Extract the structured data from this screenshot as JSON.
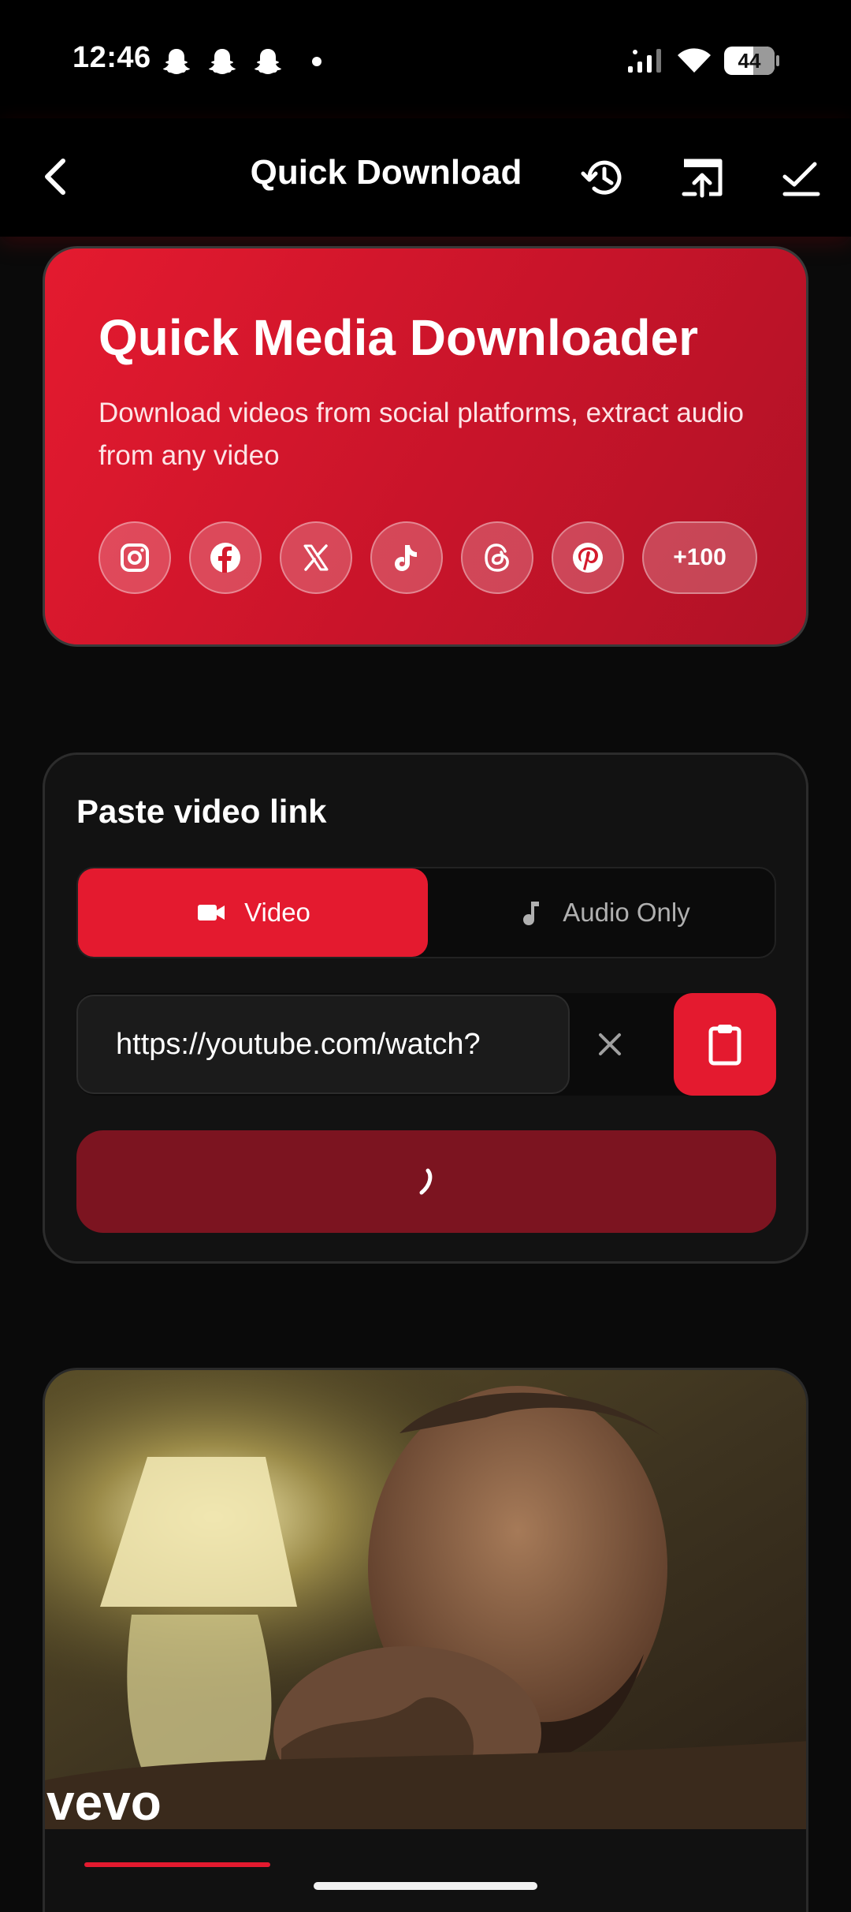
{
  "status": {
    "time": "12:46",
    "battery": "44",
    "icons": [
      "snapchat-icon",
      "snapchat-icon",
      "snapchat-icon",
      "notification-dot",
      "signal-icon",
      "wifi-icon",
      "battery-icon"
    ]
  },
  "header": {
    "title": "Quick Download",
    "icons": [
      "back-arrow-icon",
      "history-icon",
      "open-in-browser-icon",
      "done-all-icon"
    ]
  },
  "hero": {
    "title": "Quick Media Downloader",
    "subtitle": "Download videos from social platforms, extract audio from any video",
    "platforms": [
      "instagram-icon",
      "facebook-icon",
      "x-icon",
      "tiktok-icon",
      "threads-icon",
      "pinterest-icon"
    ],
    "more_label": "+100"
  },
  "paste": {
    "title": "Paste video link",
    "mode_video_label": "Video",
    "mode_audio_label": "Audio Only",
    "selected_mode": "Video",
    "url_value": "https://youtube.com/watch?",
    "download_state": "loading"
  },
  "preview": {
    "watermark": "vevo"
  },
  "colors": {
    "accent": "#e41a2f",
    "accent_dark": "#7c1420",
    "background": "#0a0a0a",
    "card": "#121212"
  }
}
